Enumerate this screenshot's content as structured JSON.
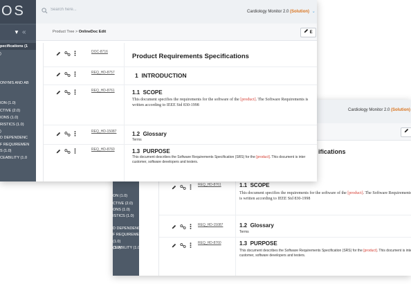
{
  "front": {
    "logo": "OS",
    "search": {
      "placeholder": "Search here..."
    },
    "project": {
      "name": "Cardiology Monitor 2.0",
      "solution": "(Solution)"
    },
    "breadcrumb": {
      "root": "Product Tree",
      "separator": ">",
      "current": "OnlineDoc Edit"
    },
    "edit_button": "E",
    "sidebar_tree": [
      {
        "text": "pecifications (1",
        "bold": true
      },
      {
        "text": ")",
        "bold": false
      },
      {
        "text": "ONYMS AND AB",
        "bold": false
      },
      {
        "text": "ION (1.0)",
        "bold": false
      },
      {
        "text": "CTIVE (2.0)",
        "bold": false
      },
      {
        "text": "IONS (1.0)",
        "bold": false
      },
      {
        "text": "RISTICS (1.0)",
        "bold": false
      },
      {
        "text": ")",
        "bold": false
      },
      {
        "text": "D DEPENDENC",
        "bold": false
      },
      {
        "text": "F REQUIREMEN",
        "bold": false
      },
      {
        "text": "S (1.0)",
        "bold": false
      },
      {
        "text": "CEABILITY (1.0",
        "bold": false
      }
    ],
    "rows": [
      {
        "id": "DOC-8716",
        "number": "",
        "title": "Product Requirements Specifications",
        "body": "",
        "body_red": "",
        "body_rest": ""
      },
      {
        "id": "REQ_HD-8757",
        "number": "1",
        "title": "INTRODUCTION",
        "body": "",
        "body_red": "",
        "body_rest": ""
      },
      {
        "id": "REQ_HD-8761",
        "number": "1.1",
        "title": "SCOPE",
        "body": "This document specifies the requirements for the software of the ",
        "body_red": "[product]",
        "body_rest": ". The Software Requirements is written according to IEEE Std 830-1998"
      },
      {
        "id": "REQ_HD-15087",
        "number": "1.2",
        "title": "Glossary",
        "body": "Terms",
        "body_red": "",
        "body_rest": ""
      },
      {
        "id": "REQ_HD-8760",
        "number": "1.3",
        "title": "PURPOSE",
        "body": "This document describes the Software Requirements Specification (SRS) for the ",
        "body_red": "[product]",
        "body_rest": ". This document is inter customer, software developers and testers."
      }
    ]
  },
  "back": {
    "project": {
      "name": "Cardiology Monitor 2.0",
      "solution": "(Solution)"
    },
    "edit_button": "",
    "title_fragment": "ifications",
    "sidebar_tree": [
      "ON (1.0)",
      "CTIVE (2.0)",
      "ONS (1.0)",
      "ISTICS (1.0)",
      "D DEPENDENC",
      "F REQUIREMEN",
      "(1.0)",
      "(1.0)",
      "CEABILITY (1.0)"
    ],
    "rows": [
      {
        "id": "REQ_HD-8761",
        "number": "1.1",
        "title": "SCOPE",
        "body": "This document specifies the requirements for the software of the ",
        "body_red": "[product]",
        "body_rest": ". The Software Requirements is written according to IEEE Std 830-1998"
      },
      {
        "id": "REQ_HD-15087",
        "number": "1.2",
        "title": "Glossary",
        "body": "Terms",
        "body_red": "",
        "body_rest": ""
      },
      {
        "id": "REQ_HD-8760",
        "number": "1.3",
        "title": "PURPOSE",
        "body": "This document describes the Software Requirements Specification (SRS) for the ",
        "body_red": "[product]",
        "body_rest": ". This document is inte customer, software developers and testers."
      }
    ]
  },
  "colors": {
    "sidebar": "#4e5a68",
    "logo_bar": "#3e4856",
    "solution": "#d9731d",
    "placeholder_red": "#d43a2f",
    "accent": "#4aa3df"
  }
}
